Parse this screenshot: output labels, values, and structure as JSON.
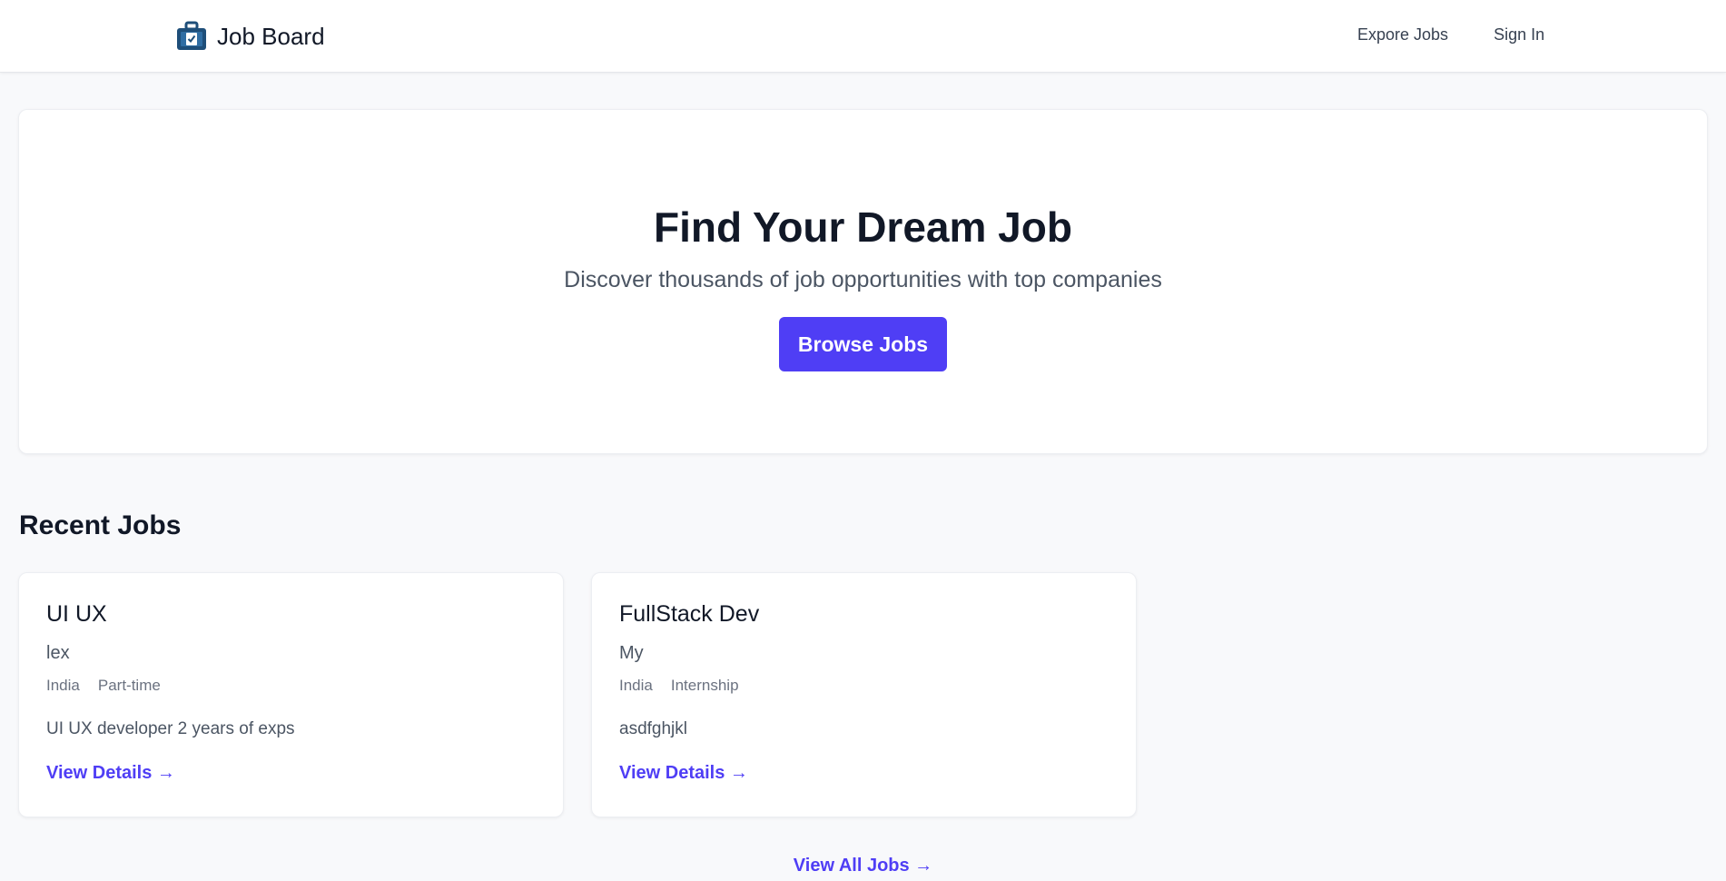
{
  "nav": {
    "brand": "Job Board",
    "brand_icon": "briefcase-icon",
    "links": [
      "Expore Jobs",
      "Sign In"
    ]
  },
  "hero": {
    "title": "Find Your Dream Job",
    "subtitle": "Discover thousands of job opportunities with top companies",
    "button": "Browse Jobs"
  },
  "recent": {
    "title": "Recent Jobs",
    "jobs": [
      {
        "title": "UI UX",
        "company": "lex",
        "location": "India",
        "type": "Part-time",
        "description": "UI UX developer 2 years of exps",
        "link": "View Details →"
      },
      {
        "title": "FullStack Dev",
        "company": "My",
        "location": "India",
        "type": "Internship",
        "description": "asdfghjkl",
        "link": "View Details →"
      }
    ],
    "view_all": "View All Jobs →"
  },
  "colors": {
    "accent": "#4f3ef5",
    "brand_icon": "#1e4e79",
    "background": "#f8f9fb"
  }
}
